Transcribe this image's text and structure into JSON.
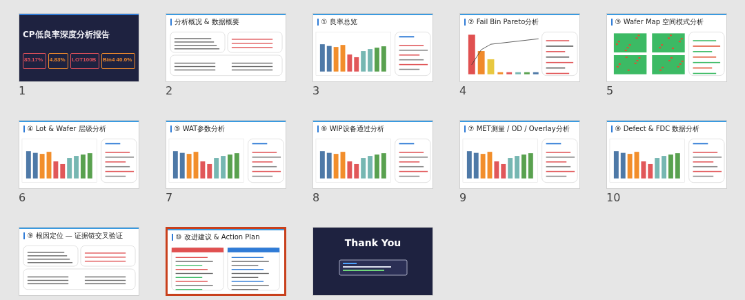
{
  "slides": [
    {
      "number": "1",
      "kind": "title",
      "selected": false,
      "title": "CP低良率深度分析报告",
      "kpis": [
        {
          "value": "85.17%",
          "color": "#e0505a"
        },
        {
          "value": "4.83%",
          "color": "#f08a2c"
        },
        {
          "value": "LOT100B",
          "color": "#e0505a"
        },
        {
          "value": "Bin4 40.0%",
          "color": "#f08a2c"
        }
      ]
    },
    {
      "number": "2",
      "kind": "text",
      "selected": false,
      "title": "分析概况 & 数据概要"
    },
    {
      "number": "3",
      "kind": "chart",
      "selected": false,
      "title": "① 良率总览"
    },
    {
      "number": "4",
      "kind": "pareto",
      "selected": false,
      "title": "② Fail Bin Pareto分析"
    },
    {
      "number": "5",
      "kind": "map",
      "selected": false,
      "title": "③ Wafer Map 空间模式分析"
    },
    {
      "number": "6",
      "kind": "chart",
      "selected": false,
      "title": "④ Lot & Wafer 层级分析"
    },
    {
      "number": "7",
      "kind": "chart",
      "selected": false,
      "title": "⑤ WAT参数分析"
    },
    {
      "number": "8",
      "kind": "chart",
      "selected": false,
      "title": "⑥ WIP设备通过分析"
    },
    {
      "number": "9",
      "kind": "chart",
      "selected": false,
      "title": "⑦ MET测量 / OD / Overlay分析"
    },
    {
      "number": "10",
      "kind": "chart",
      "selected": false,
      "title": "⑧ Defect & FDC 数据分析"
    },
    {
      "kind": "text",
      "selected": false,
      "title": "⑨ 根因定位 — 证据链交叉验证"
    },
    {
      "kind": "plan",
      "selected": true,
      "title": "⑩ 改进建议 & Action Plan"
    },
    {
      "kind": "end",
      "selected": false,
      "title": "Thank You"
    }
  ]
}
